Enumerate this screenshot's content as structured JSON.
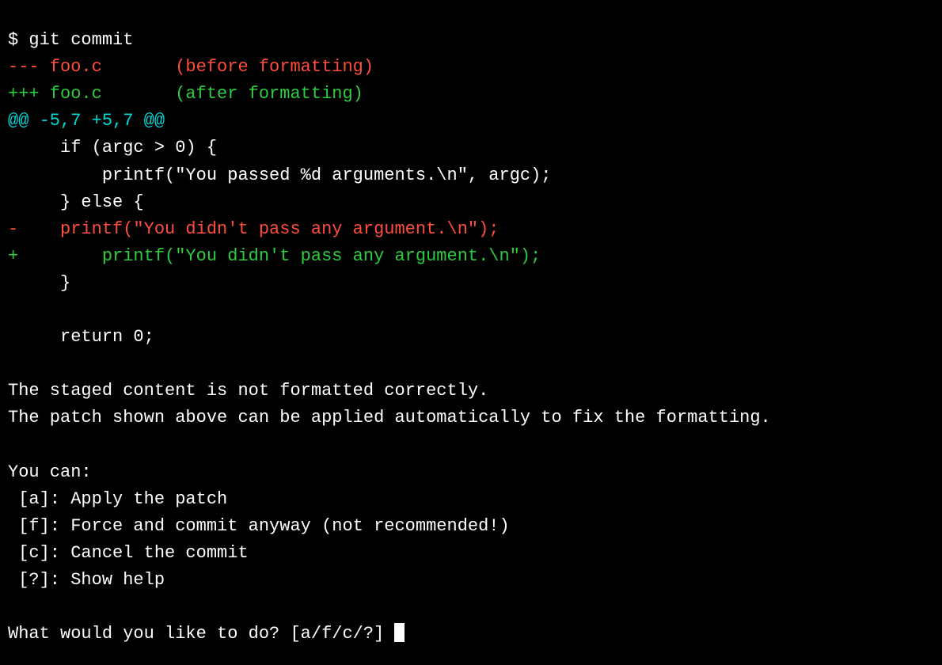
{
  "prompt_symbol": "$ ",
  "command": "git commit",
  "diff": {
    "minus_header": "--- foo.c       (before formatting)",
    "plus_header": "+++ foo.c       (after formatting)",
    "hunk_header": "@@ -5,7 +5,7 @@",
    "context1": "     if (argc > 0) {",
    "context2": "         printf(\"You passed %d arguments.\\n\", argc);",
    "context3": "     } else {",
    "removed": "-    printf(\"You didn't pass any argument.\\n\");",
    "added": "+        printf(\"You didn't pass any argument.\\n\");",
    "context4": "     }",
    "context5": " ",
    "context6": "     return 0;"
  },
  "message": {
    "line1": "The staged content is not formatted correctly.",
    "line2": "The patch shown above can be applied automatically to fix the formatting."
  },
  "options": {
    "intro": "You can:",
    "a": " [a]: Apply the patch",
    "f": " [f]: Force and commit anyway (not recommended!)",
    "c": " [c]: Cancel the commit",
    "q": " [?]: Show help"
  },
  "prompt_question": "What would you like to do? [a/f/c/?] "
}
